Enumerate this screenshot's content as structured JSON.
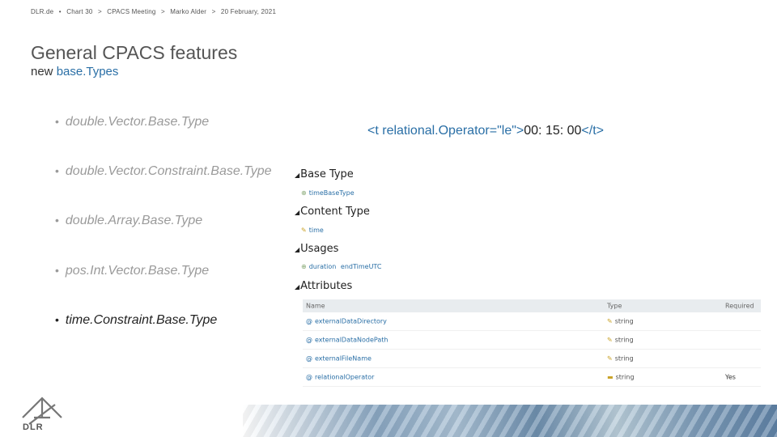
{
  "header": {
    "org": "DLR.de",
    "sep1": "•",
    "chart": "Chart 30",
    "sep2": ">",
    "meeting": "CPACS Meeting",
    "sep3": ">",
    "author": "Marko Alder",
    "sep4": ">",
    "date": "20 February, 2021"
  },
  "title": "General CPACS features",
  "subtitle": {
    "prefix": "new ",
    "highlight": "base.Types"
  },
  "bullets": [
    {
      "text": "double.Vector.Base.Type",
      "active": false
    },
    {
      "text": "double.Vector.Constraint.Base.Type",
      "active": false
    },
    {
      "text": "double.Array.Base.Type",
      "active": false
    },
    {
      "text": "pos.Int.Vector.Base.Type",
      "active": false
    },
    {
      "text": "time.Constraint.Base.Type",
      "active": true
    }
  ],
  "bullet_glyph": "•",
  "code": {
    "open": "<t relational.Operator=\"le\">",
    "value": "00: 15: 00",
    "close": "</t>"
  },
  "panel": {
    "base_type": {
      "heading": "Base Type",
      "item": "timeBaseType"
    },
    "content_type": {
      "heading": "Content Type",
      "item": "time"
    },
    "usages": {
      "heading": "Usages",
      "items": [
        "duration",
        "endTimeUTC"
      ]
    },
    "attributes": {
      "heading": "Attributes",
      "columns": [
        "Name",
        "Type",
        "Required"
      ],
      "rows": [
        {
          "name": "externalDataDirectory",
          "type": "string",
          "required": ""
        },
        {
          "name": "externalDataNodePath",
          "type": "string",
          "required": ""
        },
        {
          "name": "externalFileName",
          "type": "string",
          "required": ""
        },
        {
          "name": "relationalOperator",
          "type": "string",
          "required": "Yes"
        }
      ]
    }
  },
  "logo": {
    "text": "DLR",
    "icon": "dlr-logo-icon"
  },
  "colors": {
    "accent": "#2a6fa6",
    "muted": "#9a9a9a"
  }
}
